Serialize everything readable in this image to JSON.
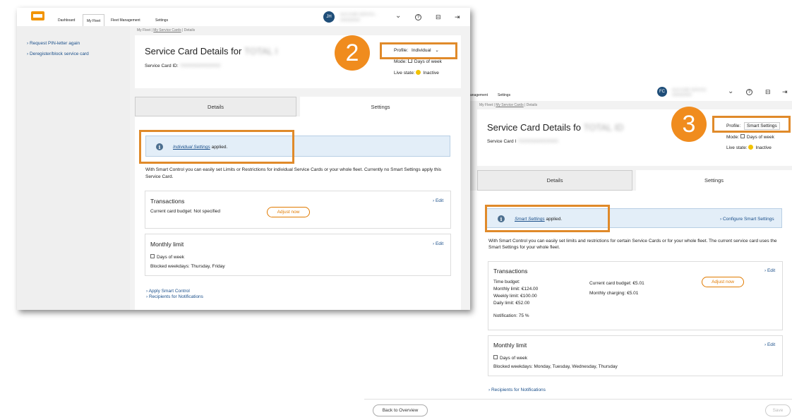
{
  "left": {
    "nav": {
      "dashboard": "Dashboard",
      "my_fleet": "My Fleet",
      "fleet_management": "Fleet Management",
      "settings": "Settings"
    },
    "avatar": "JH",
    "user_line1": "AUS KUBE SERVICE...",
    "user_line2": "0000000000",
    "breadcrumb": {
      "a": "My Fleet",
      "b": "My Service Cards",
      "c": "Details"
    },
    "sidebar": [
      "› Request PIN-letter again",
      "› Deregister/block service card"
    ],
    "title": "Service Card Details for",
    "title_blur": "TOTAL I",
    "card_id_label": "Service Card ID:",
    "card_id_blur": "7000000000000000",
    "profile_label": "Profile:",
    "profile_value": "Individual",
    "mode_label": "Mode:",
    "mode_value": "Days of week",
    "live_label": "Live state:",
    "live_value": "Inactive",
    "tabs": {
      "details": "Details",
      "settings": "Settings"
    },
    "info_link": "Individual Settings",
    "info_text": "applied.",
    "description": "With Smart Control you can easily set Limits or Restrictions for individual Service Cards or your whole fleet. Currently no Smart Settings apply this Service Card.",
    "transactions": {
      "title": "Transactions",
      "edit": "› Edit",
      "budget": "Current card budget: Not specified",
      "adjust": "Adjust now"
    },
    "monthly": {
      "title": "Monthly limit",
      "edit": "› Edit",
      "days": "Days of week",
      "blocked": "Blocked weekdays: Thursday, Friday"
    },
    "bottom_links": [
      "› Apply Smart Control",
      "› Recipients for Notifications"
    ],
    "badge": "2"
  },
  "right": {
    "nav": {
      "management": "anagement",
      "settings": "Settings"
    },
    "avatar": "FC",
    "user_line1": "AUS KUBE SERVICE",
    "user_line2": "0000000000",
    "breadcrumb": {
      "a": "My Fleet",
      "b": "My Service Cards",
      "c": "Details"
    },
    "title": "Service Card Details fo",
    "title_blur": "TOTAL ID",
    "card_id_label": "Service Card I",
    "card_id_blur": "7000000000000000",
    "profile_label": "Profile:",
    "profile_value": "Smart Settings",
    "mode_label": "Mode:",
    "mode_value": "Days of week",
    "live_label": "Live state:",
    "live_value": "Inactive",
    "tabs": {
      "details": "Details",
      "settings": "Settings"
    },
    "info_link": "Smart Settings",
    "info_text": "applied.",
    "configure": "› Configure Smart Settings",
    "description": "With Smart Control you can easily set limits and restrictions for certain Service Cards or for your whole fleet. The current service card uses the Smart Settings for your whole fleet.",
    "transactions": {
      "title": "Transactions",
      "edit": "› Edit",
      "time_budget": "Time budget:",
      "monthly": "Monthly limit: €124.00",
      "weekly": "Weekly limit: €100.00",
      "daily": "Daily limit: €52.00",
      "notification": "Notification: 75 %",
      "current_budget": "Current card budget: €5.01",
      "monthly_charging": "Monthly charging: €5.01",
      "adjust": "Adjust now"
    },
    "monthly": {
      "title": "Monthly limit",
      "edit": "› Edit",
      "days": "Days of week",
      "blocked": "Blocked weekdays: Monday, Tuesday, Wednesday, Thursday"
    },
    "recipients": "› Recipients for Notifications",
    "back": "Back to Overview",
    "save": "Save",
    "badge": "3"
  },
  "colors": {
    "accent": "#e07a00",
    "highlight": "#e08a2a",
    "badge": "#f08c1e",
    "info_bg": "#e3eef8",
    "link": "#1a4f8a",
    "live": "#f2c200"
  }
}
